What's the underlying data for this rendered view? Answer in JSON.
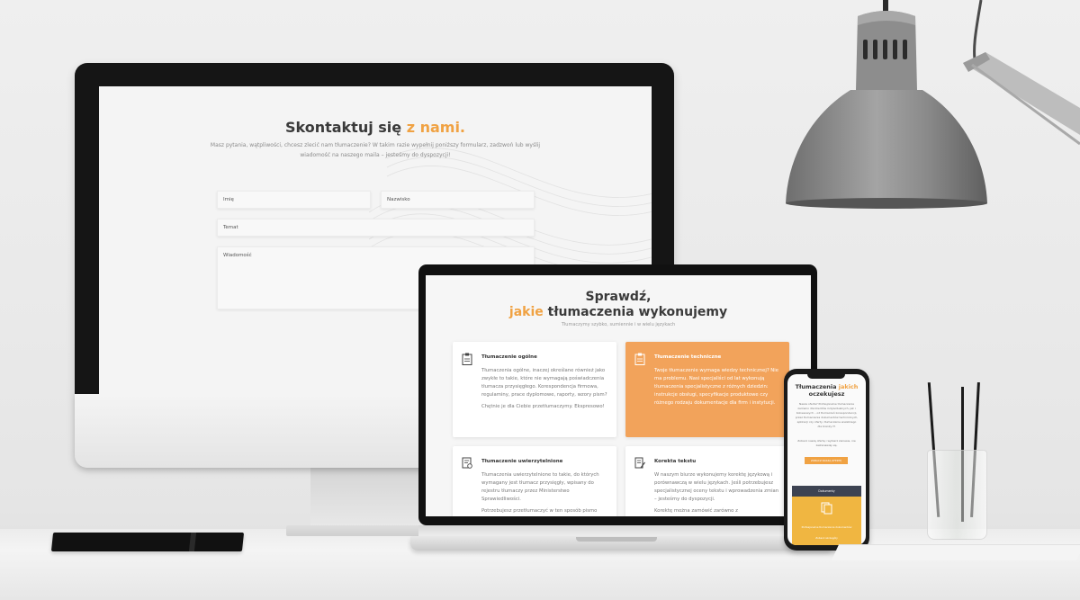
{
  "desktop_page": {
    "title_main": "Skontaktuj się",
    "title_accent": "z nami.",
    "description": "Masz pytania, wątpliwości, chcesz zlecić nam tłumaczenie? W takim razie wypełnij poniższy formularz, zadzwoń lub wyślij wiadomość na naszego maila – jesteśmy do dyspozycji!",
    "fields": {
      "first_name": "Imię",
      "last_name": "Nazwisko",
      "subject": "Temat",
      "message": "Wiadomość"
    }
  },
  "laptop_page": {
    "title_line1": "Sprawdź,",
    "title_accent": "jakie",
    "title_rest": "tłumaczenia wykonujemy",
    "subtitle": "Tłumaczymy szybko, sumiennie i w wielu językach",
    "cards": [
      {
        "title": "Tłumaczenie ogólne",
        "body": "Tłumaczenia ogólne, inaczej określane również jako zwykłe to takie, które nie wymagają poświadczenia tłumacza przysięgłego. Korespondencja firmowa, regulaminy, prace dyplomowe, raporty, wzory pism?",
        "body2": "Chętnie je dla Ciebie przetłumaczymy. Ekspresowo!"
      },
      {
        "title": "Tłumaczenie techniczne",
        "body": "Twoje tłumaczenie wymaga wiedzy technicznej? Nie ma problemu. Nasi specjaliści od lat wykonują tłumaczenia specjalistyczne z różnych dziedzin: instrukcje obsługi, specyfikacje produktowe czy różnego rodzaju dokumentacje dla firm i instytucji."
      },
      {
        "title": "Tłumaczenie uwierzytelnione",
        "body": "Tłumaczenia uwierzytelnione to takie, do których wymagany jest tłumacz przysięgły, wpisany do rejestru tłumaczy przez Ministerstwo Sprawiedliwości.",
        "body2": "Potrzebujesz przetłumaczyć w ten sposób pismo"
      },
      {
        "title": "Korekta tekstu",
        "body": "W naszym biurze wykonujemy korektę językową i porównawczą w wielu językach. Jeśli potrzebujesz specjalistycznej oceny tekstu i wprowadzenia zmian – jesteśmy do dyspozycji.",
        "body2": "Korektę można zamówić zarówno z"
      }
    ]
  },
  "phone_page": {
    "title_line1": "Tłumaczenia",
    "title_accent": "jakich",
    "title_line2": "oczekujesz",
    "intro": "Nasza oferta? Profesjonalne tłumaczenia zarówno dla klientów indywidualnych, jak i biznesowych – od tłumaczeń korespondencji, przez tłumaczenia dokumentów technicznych, aplikacji czy oferty, tłumaczenie wszelkiego dla branży IT.",
    "intro2": "Zobacz naszą ofertę i wybierz zaniesie, nie zastanawiaj się.",
    "button": "ZOBACZ NASZĄ OFERTĘ",
    "dark_label": "Dokumenty",
    "block_text1": "Profesjonalne tłumaczenie dokumentów",
    "block_text2": "Zobacz szczegóły"
  },
  "colors": {
    "accent": "#f0a243",
    "card_orange": "#f2a35b",
    "phone_yellow": "#f0b641",
    "phone_dark": "#3d4352"
  }
}
